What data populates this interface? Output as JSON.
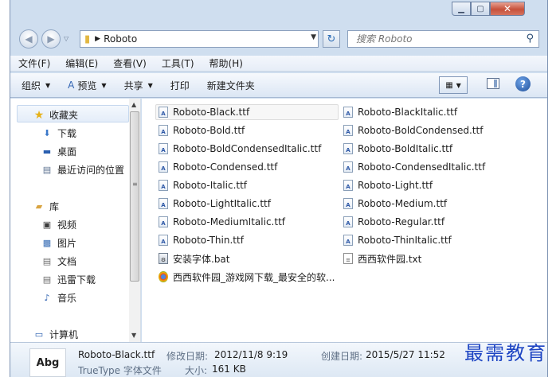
{
  "window": {
    "address_path": "Roboto",
    "search_placeholder": "搜索 Roboto"
  },
  "menu": [
    "文件(F)",
    "编辑(E)",
    "查看(V)",
    "工具(T)",
    "帮助(H)"
  ],
  "toolbar": {
    "organize": "组织",
    "preview": "预览",
    "share": "共享",
    "print": "打印",
    "new_folder": "新建文件夹"
  },
  "nav": {
    "favorites": "收藏夹",
    "downloads": "下载",
    "desktop": "桌面",
    "recent": "最近访问的位置",
    "libraries": "库",
    "videos": "视频",
    "pictures": "图片",
    "documents": "文档",
    "thunder": "迅雷下载",
    "music": "音乐",
    "computer": "计算机"
  },
  "files": [
    "Roboto-Black.ttf",
    "Roboto-BlackItalic.ttf",
    "Roboto-Bold.ttf",
    "Roboto-BoldCondensed.ttf",
    "Roboto-BoldCondensedItalic.ttf",
    "Roboto-BoldItalic.ttf",
    "Roboto-Condensed.ttf",
    "Roboto-CondensedItalic.ttf",
    "Roboto-Italic.ttf",
    "Roboto-Light.ttf",
    "Roboto-LightItalic.ttf",
    "Roboto-Medium.ttf",
    "Roboto-MediumItalic.ttf",
    "Roboto-Regular.ttf",
    "Roboto-Thin.ttf",
    "Roboto-ThinItalic.ttf",
    "安装字体.bat",
    "西西软件园.txt",
    "西西软件园_游戏网下载_最安全的软..."
  ],
  "details": {
    "thumb_text": "Abg",
    "filename": "Roboto-Black.ttf",
    "modified_label": "修改日期:",
    "modified_value": "2012/11/8 9:19",
    "created_label": "创建日期:",
    "created_value": "2015/5/27 11:52",
    "type": "TrueType 字体文件",
    "size_label": "大小:",
    "size_value": "161 KB"
  },
  "watermark": "最需教育"
}
